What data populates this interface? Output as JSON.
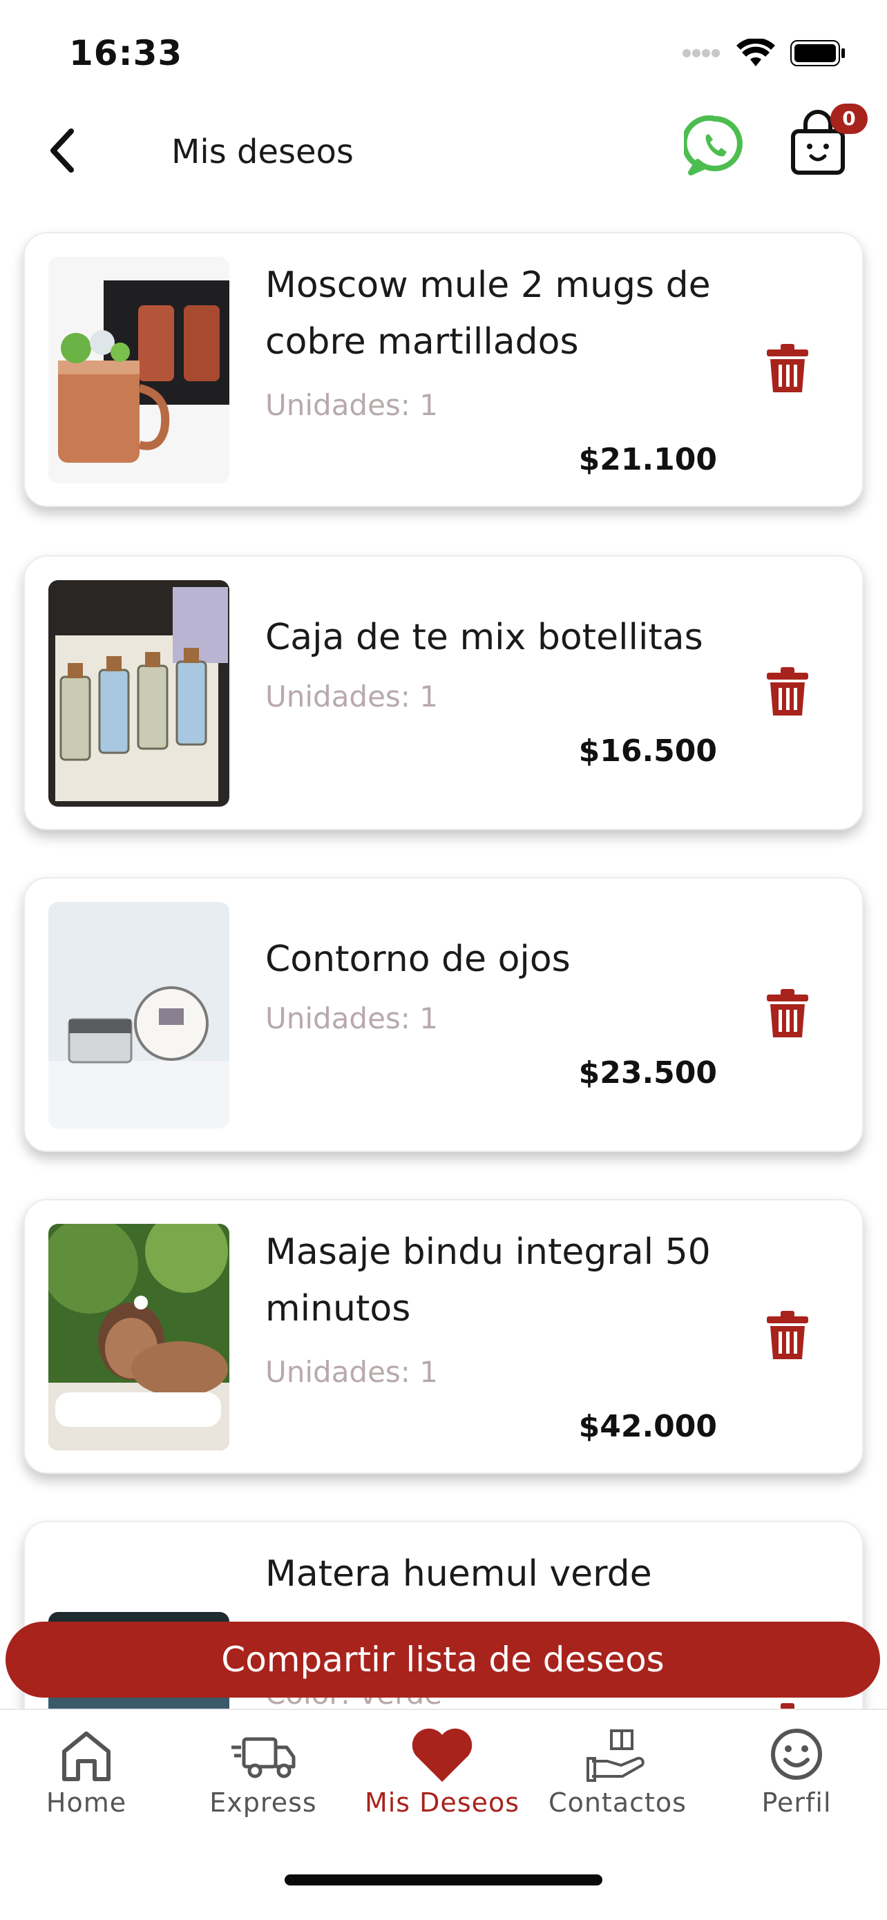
{
  "status_bar": {
    "time": "16:33"
  },
  "header": {
    "title": "Mis deseos",
    "cart_count": "0"
  },
  "items": [
    {
      "title": "Moscow mule 2 mugs de cobre martillados",
      "units": "Unidades: 1",
      "price": "$21.100"
    },
    {
      "title": "Caja de te mix botellitas",
      "units": "Unidades: 1",
      "price": "$16.500"
    },
    {
      "title": "Contorno de ojos",
      "units": "Unidades: 1",
      "price": "$23.500"
    },
    {
      "title": "Masaje bindu integral 50 minutos",
      "units": "Unidades: 1",
      "price": "$42.000"
    },
    {
      "title": "Matera huemul verde",
      "units": "Color: verde",
      "price": ""
    }
  ],
  "share_button": {
    "label": "Compartir lista de deseos"
  },
  "tabs": [
    {
      "label": "Home",
      "icon": "home-icon"
    },
    {
      "label": "Express",
      "icon": "truck-icon"
    },
    {
      "label": "Mis Deseos",
      "icon": "heart-icon",
      "active": true
    },
    {
      "label": "Contactos",
      "icon": "gift-hand-icon"
    },
    {
      "label": "Perfil",
      "icon": "smiley-icon"
    }
  ],
  "colors": {
    "accent": "#a8231c",
    "whatsapp": "#4cbd4f",
    "muted_text": "#b8a9ab"
  }
}
